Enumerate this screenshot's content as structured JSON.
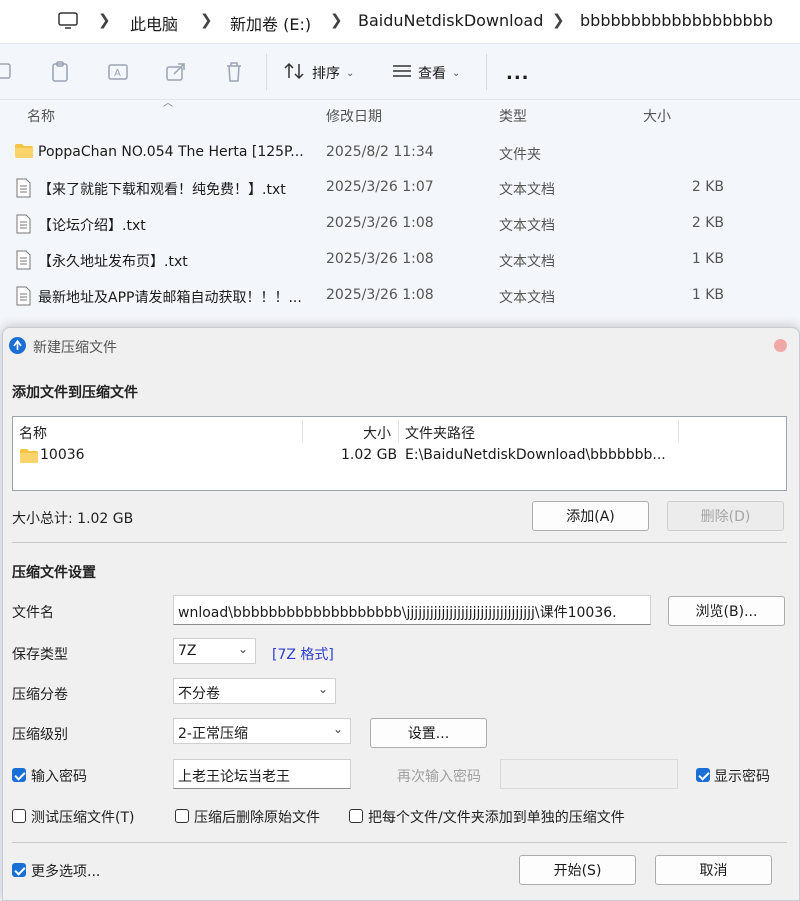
{
  "explorer": {
    "breadcrumb": [
      "此电脑",
      "新加卷 (E:)",
      "BaiduNetdiskDownload",
      "bbbbbbbbbbbbbbbbbbb"
    ],
    "toolbar": {
      "sort_label": "排序",
      "view_label": "查看",
      "more_label": "..."
    },
    "columns": {
      "name": "名称",
      "date": "修改日期",
      "type": "类型",
      "size": "大小"
    },
    "files": [
      {
        "name": "PoppaChan NO.054 The Herta [125P...",
        "date": "2025/8/2 11:34",
        "type": "文件夹",
        "size": "",
        "icon": "folder-icon"
      },
      {
        "name": "【来了就能下载和观看！纯免费！】.txt",
        "date": "2025/3/26 1:07",
        "type": "文本文档",
        "size": "2 KB",
        "icon": "text-file-icon"
      },
      {
        "name": "【论坛介绍】.txt",
        "date": "2025/3/26 1:08",
        "type": "文本文档",
        "size": "2 KB",
        "icon": "text-file-icon"
      },
      {
        "name": "【永久地址发布页】.txt",
        "date": "2025/3/26 1:08",
        "type": "文本文档",
        "size": "1 KB",
        "icon": "text-file-icon"
      },
      {
        "name": "最新地址及APP请发邮箱自动获取！！！...",
        "date": "2025/3/26 1:08",
        "type": "文本文档",
        "size": "1 KB",
        "icon": "text-file-icon"
      }
    ]
  },
  "dialog": {
    "title": "新建压缩文件",
    "add_section_title": "添加文件到压缩文件",
    "list_headers": {
      "name": "名称",
      "size": "大小",
      "path": "文件夹路径"
    },
    "list_items": [
      {
        "name": "10036",
        "size": "1.02 GB",
        "path": "E:\\BaiduNetdiskDownload\\bbbbbbb..."
      }
    ],
    "total_size": "大小总计: 1.02 GB",
    "add_button": "添加(A)",
    "delete_button": "删除(D)",
    "settings_title": "压缩文件设置",
    "filename_label": "文件名",
    "filename_value": "wnload\\bbbbbbbbbbbbbbbbbbb\\jjjjjjjjjjjjjjjjjjjjjjjjjjjjjjjjj\\课件10036.",
    "browse_button": "浏览(B)...",
    "save_type_label": "保存类型",
    "save_type_value": "7Z",
    "format_link": "[7Z 格式]",
    "split_label": "压缩分卷",
    "split_value": "不分卷",
    "level_label": "压缩级别",
    "level_value": "2-正常压缩",
    "settings_button": "设置...",
    "password_label": "输入密码",
    "password_value": "上老王论坛当老王",
    "reenter_label": "再次输入密码",
    "show_password_label": "显示密码",
    "test_label": "测试压缩文件(T)",
    "delete_after_label": "压缩后删除原始文件",
    "separate_label": "把每个文件/文件夹添加到单独的压缩文件",
    "more_options_label": "更多选项...",
    "start_button": "开始(S)",
    "cancel_button": "取消"
  }
}
